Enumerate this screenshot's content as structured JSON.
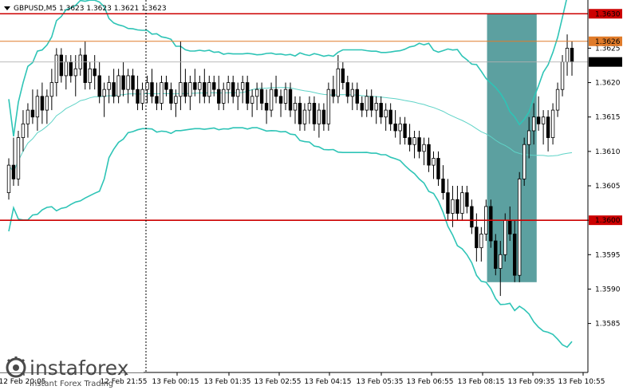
{
  "header": {
    "ticker_line": "GBPUSD,M5  1.3623 1.3623 1.3621 1.3623"
  },
  "watermark": {
    "brand": "instaforex",
    "tagline": "Instant Forex Trading"
  },
  "colors": {
    "bull_candle": "#ffffff",
    "bear_candle": "#000000",
    "bollinger": "#2ec4b6",
    "moving_average": "#5fd3c7",
    "resistance_line": "#cc0000",
    "level_1_3626": "#e07b2a",
    "highlight_zone": "#3f8f8f",
    "current_price_tag": "#000000",
    "red_tag": "#cc0000"
  },
  "chart_data": {
    "type": "candlestick",
    "symbol": "GBPUSD",
    "timeframe": "M5",
    "ylim": [
      1.3578,
      1.3632
    ],
    "y_ticks": [
      "1.3625",
      "1.3620",
      "1.3615",
      "1.3610",
      "1.3605",
      "1.3600",
      "1.3595",
      "1.3590",
      "1.3585"
    ],
    "x_ticks": [
      "12 Feb 20:05",
      "12 Feb 21:55",
      "13 Feb 00:15",
      "13 Feb 01:35",
      "13 Feb 02:55",
      "13 Feb 04:15",
      "13 Feb 05:35",
      "13 Feb 06:55",
      "13 Feb 08:15",
      "13 Feb 09:35",
      "13 Feb 10:55"
    ],
    "horizontal_lines": [
      {
        "price": 1.363,
        "label": "1.3630",
        "style": "red"
      },
      {
        "price": 1.3626,
        "label": "1.3626",
        "style": "orange"
      },
      {
        "price": 1.36,
        "label": "1.3600",
        "style": "red"
      }
    ],
    "current_price": {
      "price": 1.3623,
      "label": "1.3623"
    },
    "highlight_zone": {
      "price_top": 1.363,
      "price_bottom": 1.3591,
      "from_candle": 0.83,
      "to_candle": 0.915
    },
    "candles": [
      [
        1.3604,
        1.3609,
        1.3603,
        1.3608
      ],
      [
        1.3608,
        1.3612,
        1.3605,
        1.3606
      ],
      [
        1.3606,
        1.3613,
        1.3605,
        1.3612
      ],
      [
        1.3612,
        1.3616,
        1.361,
        1.3614
      ],
      [
        1.3614,
        1.3617,
        1.3612,
        1.3616
      ],
      [
        1.3616,
        1.3619,
        1.3614,
        1.3615
      ],
      [
        1.3615,
        1.3619,
        1.3613,
        1.3618
      ],
      [
        1.3618,
        1.362,
        1.3614,
        1.3616
      ],
      [
        1.3616,
        1.3619,
        1.3614,
        1.3618
      ],
      [
        1.3618,
        1.3622,
        1.3616,
        1.362
      ],
      [
        1.362,
        1.3625,
        1.3618,
        1.3624
      ],
      [
        1.3624,
        1.3625,
        1.362,
        1.3621
      ],
      [
        1.3621,
        1.3624,
        1.3619,
        1.3623
      ],
      [
        1.3623,
        1.3624,
        1.362,
        1.3621
      ],
      [
        1.3621,
        1.3624,
        1.3618,
        1.3622
      ],
      [
        1.3622,
        1.3625,
        1.3621,
        1.3624
      ],
      [
        1.3624,
        1.3626,
        1.3619,
        1.362
      ],
      [
        1.362,
        1.3623,
        1.3619,
        1.3622
      ],
      [
        1.3622,
        1.3624,
        1.3619,
        1.3621
      ],
      [
        1.3621,
        1.3623,
        1.3617,
        1.3618
      ],
      [
        1.3618,
        1.362,
        1.3615,
        1.3619
      ],
      [
        1.3619,
        1.3621,
        1.3617,
        1.362
      ],
      [
        1.362,
        1.3622,
        1.3617,
        1.3618
      ],
      [
        1.3618,
        1.3622,
        1.3617,
        1.3621
      ],
      [
        1.3621,
        1.3623,
        1.3618,
        1.3619
      ],
      [
        1.3619,
        1.3622,
        1.3617,
        1.3621
      ],
      [
        1.3621,
        1.3622,
        1.3618,
        1.3619
      ],
      [
        1.3619,
        1.3621,
        1.3616,
        1.3617
      ],
      [
        1.3617,
        1.362,
        1.3616,
        1.3619
      ],
      [
        1.3619,
        1.3621,
        1.3617,
        1.362
      ],
      [
        1.362,
        1.3622,
        1.3617,
        1.3618
      ],
      [
        1.3618,
        1.362,
        1.3616,
        1.3617
      ],
      [
        1.3617,
        1.3621,
        1.3616,
        1.362
      ],
      [
        1.362,
        1.3621,
        1.3618,
        1.3619
      ],
      [
        1.3619,
        1.362,
        1.3616,
        1.3617
      ],
      [
        1.3617,
        1.3619,
        1.3615,
        1.3618
      ],
      [
        1.3618,
        1.3626,
        1.3616,
        1.362
      ],
      [
        1.362,
        1.3622,
        1.3617,
        1.3618
      ],
      [
        1.3618,
        1.3621,
        1.3616,
        1.362
      ],
      [
        1.362,
        1.3622,
        1.3618,
        1.3619
      ],
      [
        1.3619,
        1.3621,
        1.3617,
        1.362
      ],
      [
        1.362,
        1.3622,
        1.3617,
        1.3618
      ],
      [
        1.3618,
        1.3621,
        1.3617,
        1.362
      ],
      [
        1.362,
        1.3621,
        1.3618,
        1.3619
      ],
      [
        1.3619,
        1.3621,
        1.3616,
        1.3617
      ],
      [
        1.3617,
        1.362,
        1.3616,
        1.3619
      ],
      [
        1.3619,
        1.3621,
        1.3617,
        1.362
      ],
      [
        1.362,
        1.3621,
        1.3617,
        1.3618
      ],
      [
        1.3618,
        1.362,
        1.3616,
        1.3619
      ],
      [
        1.3619,
        1.3621,
        1.3617,
        1.362
      ],
      [
        1.362,
        1.3621,
        1.3616,
        1.3617
      ],
      [
        1.3617,
        1.3619,
        1.3615,
        1.3618
      ],
      [
        1.3618,
        1.362,
        1.3616,
        1.3619
      ],
      [
        1.3619,
        1.362,
        1.3616,
        1.3617
      ],
      [
        1.3617,
        1.3619,
        1.3614,
        1.3616
      ],
      [
        1.3616,
        1.362,
        1.3615,
        1.3619
      ],
      [
        1.3619,
        1.3621,
        1.3617,
        1.3618
      ],
      [
        1.3618,
        1.3619,
        1.3615,
        1.3617
      ],
      [
        1.3617,
        1.362,
        1.3616,
        1.3619
      ],
      [
        1.3619,
        1.362,
        1.3615,
        1.3616
      ],
      [
        1.3616,
        1.3618,
        1.3614,
        1.3617
      ],
      [
        1.3617,
        1.3618,
        1.3613,
        1.3614
      ],
      [
        1.3614,
        1.3617,
        1.3613,
        1.3616
      ],
      [
        1.3616,
        1.3618,
        1.3614,
        1.3617
      ],
      [
        1.3617,
        1.3618,
        1.3613,
        1.3614
      ],
      [
        1.3614,
        1.3617,
        1.3612,
        1.3616
      ],
      [
        1.3616,
        1.3617,
        1.3613,
        1.3614
      ],
      [
        1.3614,
        1.362,
        1.3613,
        1.3619
      ],
      [
        1.3619,
        1.3621,
        1.3617,
        1.3618
      ],
      [
        1.3618,
        1.3624,
        1.3617,
        1.3622
      ],
      [
        1.3622,
        1.3623,
        1.3619,
        1.362
      ],
      [
        1.362,
        1.3621,
        1.3617,
        1.3618
      ],
      [
        1.3618,
        1.362,
        1.3616,
        1.3619
      ],
      [
        1.3619,
        1.362,
        1.3616,
        1.3617
      ],
      [
        1.3617,
        1.3618,
        1.3615,
        1.3616
      ],
      [
        1.3616,
        1.3619,
        1.3615,
        1.3618
      ],
      [
        1.3618,
        1.3619,
        1.3615,
        1.3616
      ],
      [
        1.3616,
        1.3618,
        1.3614,
        1.3617
      ],
      [
        1.3617,
        1.3618,
        1.3614,
        1.3615
      ],
      [
        1.3615,
        1.3617,
        1.3613,
        1.3616
      ],
      [
        1.3616,
        1.3617,
        1.3613,
        1.3614
      ],
      [
        1.3614,
        1.3616,
        1.3612,
        1.3613
      ],
      [
        1.3613,
        1.3615,
        1.3611,
        1.3614
      ],
      [
        1.3614,
        1.3615,
        1.3611,
        1.3612
      ],
      [
        1.3612,
        1.3614,
        1.361,
        1.3611
      ],
      [
        1.3611,
        1.3613,
        1.3609,
        1.3612
      ],
      [
        1.3612,
        1.3613,
        1.3609,
        1.361
      ],
      [
        1.361,
        1.3612,
        1.3608,
        1.3611
      ],
      [
        1.3611,
        1.3612,
        1.3607,
        1.3608
      ],
      [
        1.3608,
        1.361,
        1.3606,
        1.3609
      ],
      [
        1.3609,
        1.361,
        1.3605,
        1.3606
      ],
      [
        1.3606,
        1.3608,
        1.3603,
        1.3604
      ],
      [
        1.3604,
        1.3606,
        1.36,
        1.3601
      ],
      [
        1.3601,
        1.3605,
        1.3599,
        1.3603
      ],
      [
        1.3603,
        1.3605,
        1.36,
        1.3601
      ],
      [
        1.3601,
        1.3605,
        1.36,
        1.3604
      ],
      [
        1.3604,
        1.3605,
        1.3601,
        1.3602
      ],
      [
        1.3602,
        1.3603,
        1.3598,
        1.3599
      ],
      [
        1.3599,
        1.3601,
        1.3594,
        1.3596
      ],
      [
        1.3596,
        1.3599,
        1.3594,
        1.3598
      ],
      [
        1.3598,
        1.3603,
        1.3597,
        1.3602
      ],
      [
        1.3602,
        1.3603,
        1.3596,
        1.3597
      ],
      [
        1.3597,
        1.3598,
        1.3592,
        1.3593
      ],
      [
        1.3593,
        1.3597,
        1.3589,
        1.3595
      ],
      [
        1.3595,
        1.3601,
        1.3594,
        1.36
      ],
      [
        1.36,
        1.3602,
        1.3597,
        1.3598
      ],
      [
        1.3598,
        1.36,
        1.3591,
        1.3592
      ],
      [
        1.3592,
        1.3607,
        1.3591,
        1.3606
      ],
      [
        1.3606,
        1.3612,
        1.3605,
        1.3611
      ],
      [
        1.3611,
        1.3615,
        1.3609,
        1.3613
      ],
      [
        1.3613,
        1.3617,
        1.3611,
        1.3615
      ],
      [
        1.3615,
        1.3618,
        1.3613,
        1.3614
      ],
      [
        1.3614,
        1.3616,
        1.3611,
        1.3615
      ],
      [
        1.3615,
        1.3616,
        1.361,
        1.3612
      ],
      [
        1.3612,
        1.3617,
        1.3611,
        1.3616
      ],
      [
        1.3616,
        1.362,
        1.3615,
        1.3619
      ],
      [
        1.3619,
        1.3624,
        1.3618,
        1.3623
      ],
      [
        1.3623,
        1.3627,
        1.3621,
        1.3625
      ],
      [
        1.3625,
        1.3626,
        1.3621,
        1.3623
      ]
    ]
  }
}
